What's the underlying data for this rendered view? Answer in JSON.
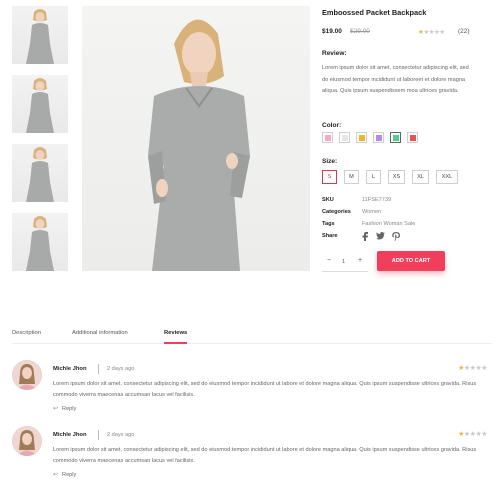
{
  "product": {
    "title": "Emboossed Packet Backpack",
    "price": "$19.00",
    "old_price": "$29.00",
    "rating_stars": 1,
    "rating_max": 5,
    "rating_count": "(22)"
  },
  "review_section": {
    "label": "Review:",
    "text": "Lorem ipsum dolor sit amet, consectetur adipiscing elit, sed do eiusmod tempor incididunt ut laboreet et dolore magna aliqua. Quis ipsum suspendissem moa ultrices gravida."
  },
  "color": {
    "label": "Color:",
    "swatches": [
      {
        "name": "pink",
        "hex": "#f5a8c8",
        "selected": false
      },
      {
        "name": "light-gray",
        "hex": "#e6e6e6",
        "selected": false
      },
      {
        "name": "orange",
        "hex": "#f3b22f",
        "selected": false
      },
      {
        "name": "purple",
        "hex": "#b58af0",
        "selected": false
      },
      {
        "name": "green",
        "hex": "#4fcf8f",
        "selected": true
      },
      {
        "name": "red",
        "hex": "#e8524f",
        "selected": false
      }
    ]
  },
  "size": {
    "label": "Size:",
    "options": [
      "S",
      "M",
      "L",
      "XS",
      "XL",
      "XXL"
    ],
    "selected": "S"
  },
  "meta": {
    "sku_label": "SKU",
    "sku_value": "11FSE7739",
    "categories_label": "Categories",
    "categories_value": "Women",
    "tags_label": "Tags",
    "tags_value": "Fashion Woman Sale",
    "share_label": "Share"
  },
  "share_icons": [
    "facebook-icon",
    "twitter-icon",
    "pinterest-icon"
  ],
  "cart": {
    "minus": "−",
    "quantity": "1",
    "plus": "+",
    "add_to_cart": "ADD TO CART"
  },
  "tabs": [
    {
      "label": "Description",
      "active": false
    },
    {
      "label": "Additional information",
      "active": false
    },
    {
      "label": "Reviews",
      "active": true
    }
  ],
  "reviews": [
    {
      "name": "Michle Jhon",
      "date": "2 days ago",
      "stars": 1,
      "text": "Lorem ipsum dolor sit amet, consectetur adipiscing elit, sed do eiusmod tempor incididunt ut labore et dolore magna aliqua. Quis ipsum suspendisse ultrices gravida. Risus commodo viverra maecenas accumsan lacus vel facilisis.",
      "reply": "Reply"
    },
    {
      "name": "Michle Jhon",
      "date": "2 days ago",
      "stars": 1,
      "text": "Lorem ipsum dolor sit amet, consectetur adipiscing elit, sed do eiusmod tempor incididunt ut labore et dolore magna aliqua. Quis ipsum suspendisse ultrices gravida. Risus commodo viverra maecenas accumsan lacus vel facilisis.",
      "reply": "Reply"
    }
  ],
  "colors": {
    "accent": "#ef3f5b",
    "star": "#f3b33d"
  }
}
